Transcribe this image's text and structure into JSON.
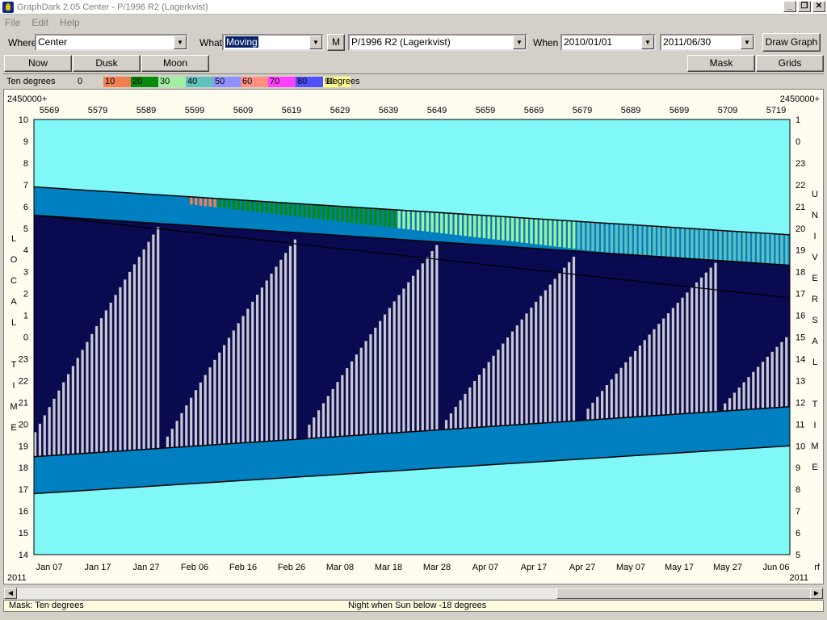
{
  "window": {
    "title": "GraphDark 2.05  Center  -  P/1996 R2 (Lagerkvist)",
    "min": "_",
    "max": "❐",
    "close": "✕"
  },
  "menu": {
    "file": "File",
    "edit": "Edit",
    "help": "Help"
  },
  "toolbar": {
    "where_label": "Where",
    "where_value": "Center",
    "what_label": "What",
    "what_value": "Moving",
    "m_button": "M",
    "object_value": "P/1996 R2 (Lagerkvist)",
    "when_label": "When",
    "start_date": "2010/01/01",
    "end_date": "2011/06/30",
    "draw_button": "Draw Graph"
  },
  "row2": {
    "now": "Now",
    "dusk": "Dusk",
    "moon": "Moon",
    "mask": "Mask",
    "grids": "Grids"
  },
  "legend": {
    "label": "Ten degrees",
    "unit": "Degrees",
    "items": [
      {
        "text": "0",
        "color": "#d4d0c8"
      },
      {
        "text": "10",
        "color": "#f08050"
      },
      {
        "text": "20",
        "color": "#0a8a0a"
      },
      {
        "text": "30",
        "color": "#a0f0a0"
      },
      {
        "text": "40",
        "color": "#60c0c0"
      },
      {
        "text": "50",
        "color": "#9090ff"
      },
      {
        "text": "60",
        "color": "#ff9080"
      },
      {
        "text": "70",
        "color": "#ff40ff"
      },
      {
        "text": "80",
        "color": "#5050ff"
      },
      {
        "text": "90",
        "color": "#ffff90"
      }
    ]
  },
  "graph": {
    "jd_prefix_left": "2450000+",
    "jd_prefix_right": "2450000+",
    "jd_ticks": [
      "5569",
      "5579",
      "5589",
      "5599",
      "5609",
      "5619",
      "5629",
      "5639",
      "5649",
      "5659",
      "5669",
      "5679",
      "5689",
      "5699",
      "5709",
      "5719"
    ],
    "left_hours": [
      "10",
      "9",
      "8",
      "7",
      "6",
      "5",
      "4",
      "3",
      "2",
      "1",
      "0",
      "23",
      "22",
      "21",
      "20",
      "19",
      "18",
      "17",
      "16",
      "15",
      "14"
    ],
    "right_hours": [
      "1",
      "0",
      "23",
      "22",
      "21",
      "20",
      "19",
      "18",
      "17",
      "16",
      "15",
      "14",
      "13",
      "12",
      "11",
      "10",
      "9",
      "8",
      "7",
      "6",
      "5"
    ],
    "left_axis_letters": [
      "L",
      "O",
      "C",
      "A",
      "L",
      "",
      "T",
      "I",
      "M",
      "E"
    ],
    "right_axis_letters": [
      "U",
      "N",
      "I",
      "V",
      "E",
      "R",
      "S",
      "A",
      "L",
      "",
      "T",
      "I",
      "M",
      "E"
    ],
    "date_ticks": [
      "Jan 07",
      "Jan 17",
      "Jan 27",
      "Feb 06",
      "Feb 16",
      "Feb 26",
      "Mar 08",
      "Mar 18",
      "Mar 28",
      "Apr 07",
      "Apr 17",
      "Apr 27",
      "May 07",
      "May 17",
      "May 27",
      "Jun 06"
    ],
    "year_left": "2011",
    "year_right": "2011",
    "corner_right": "rf",
    "colors": {
      "day": "#80f8f8",
      "twilight": "#0080c0",
      "night": "#0a0a50",
      "moon": "#c8c8d0",
      "alt10": "#f08050",
      "alt20": "#0a8a0a",
      "alt30": "#a0f0a0",
      "alt40": "#60c0c0"
    }
  },
  "status": {
    "left": "Mask:  Ten degrees",
    "center": "Night when Sun below -18 degrees"
  }
}
